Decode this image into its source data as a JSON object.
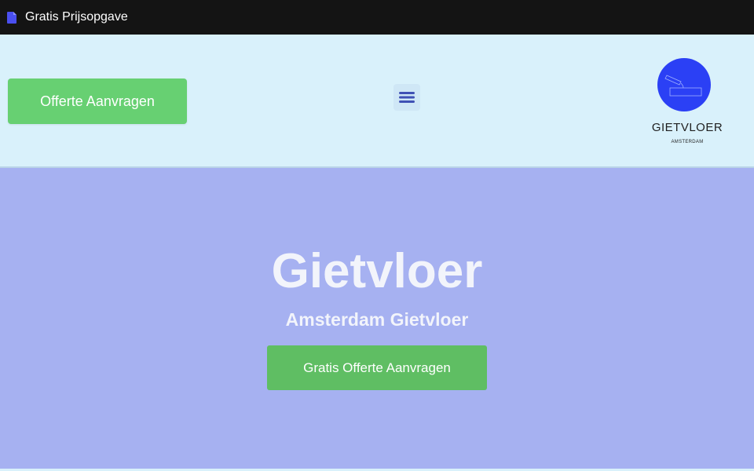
{
  "window": {
    "title": "Gratis Prijsopgave",
    "icon": "document-icon"
  },
  "header": {
    "cta_label": "Offerte Aanvragen",
    "menu_icon": "hamburger-menu-icon",
    "logo": {
      "name": "GIETVLOER",
      "sub": "AMSTERDAM"
    }
  },
  "hero": {
    "title": "Gietvloer",
    "subtitle": "Amsterdam Gietvloer",
    "cta_label": "Gratis Offerte Aanvragen"
  },
  "colors": {
    "topbar": "#141414",
    "header_bg": "#d9f1fb",
    "hero_bg": "#a6b1f1",
    "button_green": "#67d072",
    "hero_button_green": "#5fbe63",
    "logo_blue": "#2b40f5",
    "menu_blue": "#3f51b5"
  }
}
